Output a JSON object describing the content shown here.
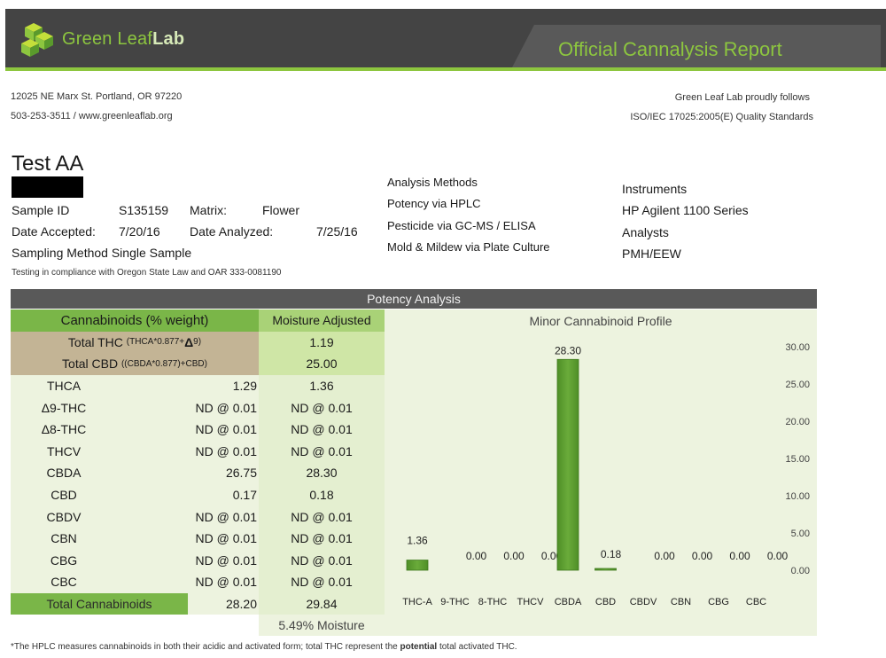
{
  "header": {
    "brand_green": "Green Leaf",
    "brand_lab": "Lab",
    "report_title": "Official Cannalysis Report"
  },
  "lab": {
    "address": "12025 NE Marx St. Portland, OR 97220",
    "contact": "503-253-3511 / www.greenleaflab.org",
    "follows": "Green Leaf Lab proudly follows",
    "standard": "ISO/IEC 17025:2005(E) Quality Standards"
  },
  "sample": {
    "title": "Test AA",
    "id_label": "Sample ID",
    "id_value": "S135159",
    "matrix_label": "Matrix:",
    "matrix_value": "Flower",
    "accepted_label": "Date Accepted:",
    "accepted_value": "7/20/16",
    "analyzed_label": "Date Analyzed:",
    "analyzed_value": "7/25/16",
    "sampling_label": "Sampling Method",
    "sampling_value": "Single Sample",
    "compliance": "Testing in compliance with Oregon State Law and OAR 333-0081190"
  },
  "methods": {
    "title": "Analysis Methods",
    "items": [
      "Potency via HPLC",
      "Pesticide via GC-MS / ELISA",
      "Mold & Mildew via Plate Culture"
    ]
  },
  "instruments": {
    "title": "Instruments",
    "value": "HP Agilent 1100 Series",
    "analysts_title": "Analysts",
    "analysts_value": "PMH/EEW"
  },
  "potency": {
    "bar_title": "Potency Analysis",
    "col_cannabinoids": "Cannabinoids (% weight)",
    "col_moisture": "Moisture Adjusted",
    "total_thc": {
      "label": "Total THC",
      "formula_a": "(THCA*0.877+",
      "delta": "Δ",
      "formula_b": "9)",
      "value": "1.19"
    },
    "total_cbd": {
      "label": "Total CBD",
      "formula": "((CBDA*0.877)+CBD)",
      "value": "25.00"
    },
    "rows": [
      {
        "name": "THCA",
        "value": "1.29",
        "adjusted": "1.36"
      },
      {
        "name": "Δ9-THC",
        "value": "ND @ 0.01",
        "adjusted": "ND @ 0.01"
      },
      {
        "name": "Δ8-THC",
        "value": "ND @ 0.01",
        "adjusted": "ND @ 0.01"
      },
      {
        "name": "THCV",
        "value": "ND @ 0.01",
        "adjusted": "ND @ 0.01"
      },
      {
        "name": "CBDA",
        "value": "26.75",
        "adjusted": "28.30"
      },
      {
        "name": "CBD",
        "value": "0.17",
        "adjusted": "0.18"
      },
      {
        "name": "CBDV",
        "value": "ND @ 0.01",
        "adjusted": "ND @ 0.01"
      },
      {
        "name": "CBN",
        "value": "ND @ 0.01",
        "adjusted": "ND @ 0.01"
      },
      {
        "name": "CBG",
        "value": "ND @ 0.01",
        "adjusted": "ND @ 0.01"
      },
      {
        "name": "CBC",
        "value": "ND @ 0.01",
        "adjusted": "ND @ 0.01"
      }
    ],
    "total": {
      "label": "Total Cannabinoids",
      "value": "28.20",
      "adjusted": "29.84"
    },
    "moisture": "5.49% Moisture"
  },
  "chart_data": {
    "type": "bar",
    "title": "Minor Cannabinoid Profile",
    "categories": [
      "THC-A",
      "9-THC",
      "8-THC",
      "THCV",
      "CBDA",
      "CBD",
      "CBDV",
      "CBN",
      "CBG",
      "CBC"
    ],
    "values": [
      1.36,
      0,
      0,
      0,
      28.3,
      0.18,
      0,
      0,
      0,
      0
    ],
    "data_labels": [
      "1.36",
      "0.00",
      "0.00",
      "0.00",
      "28.30",
      "0.18",
      "0.00",
      "0.00",
      "0.00",
      "0.00"
    ],
    "y_ticks": [
      "0.00",
      "5.00",
      "10.00",
      "15.00",
      "20.00",
      "25.00",
      "30.00"
    ],
    "ylim": [
      0,
      30
    ],
    "y_axis_side": "right",
    "grid": false,
    "bar_color": "#6aab3a"
  },
  "footnote": {
    "before": "*The HPLC measures cannabinoids in both their acidic and activated form; total THC represent the ",
    "emph": "potential",
    "after": " total activated THC."
  }
}
